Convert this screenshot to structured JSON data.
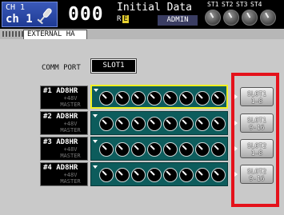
{
  "channel": {
    "line1": "CH 1",
    "line2": "ch 1",
    "icon": "microphone-icon"
  },
  "scene": {
    "number": "000",
    "title": "Initial Data",
    "flag_r": "R",
    "flag_e": "E"
  },
  "user": {
    "name": "ADMIN"
  },
  "stereo_labels": [
    "ST1",
    "ST2",
    "ST3",
    "ST4"
  ],
  "tab": {
    "label": "EXTERNAL HA"
  },
  "comm_port": {
    "label": "COMM PORT",
    "value": "SLOT1"
  },
  "units": [
    {
      "name": "#1 AD8HR",
      "sub1": "+48V",
      "sub2": "MASTER"
    },
    {
      "name": "#2 AD8HR",
      "sub1": "+48V",
      "sub2": "MASTER"
    },
    {
      "name": "#3 AD8HR",
      "sub1": "+48V",
      "sub2": "MASTER"
    },
    {
      "name": "#4 AD8HR",
      "sub1": "+48V",
      "sub2": "MASTER"
    }
  ],
  "slot_buttons": [
    {
      "line1": "SLOT1",
      "line2": "1-8"
    },
    {
      "line1": "SLOT1",
      "line2": "9-16"
    },
    {
      "line1": "SLOT2",
      "line2": "1-8"
    },
    {
      "line1": "SLOT2",
      "line2": "9-16"
    }
  ],
  "colors": {
    "highlight_frame": "#e4121b",
    "selected_strip": "#f0f020",
    "strip": "#0d5c5c",
    "scene_flag": "#e8d230"
  }
}
